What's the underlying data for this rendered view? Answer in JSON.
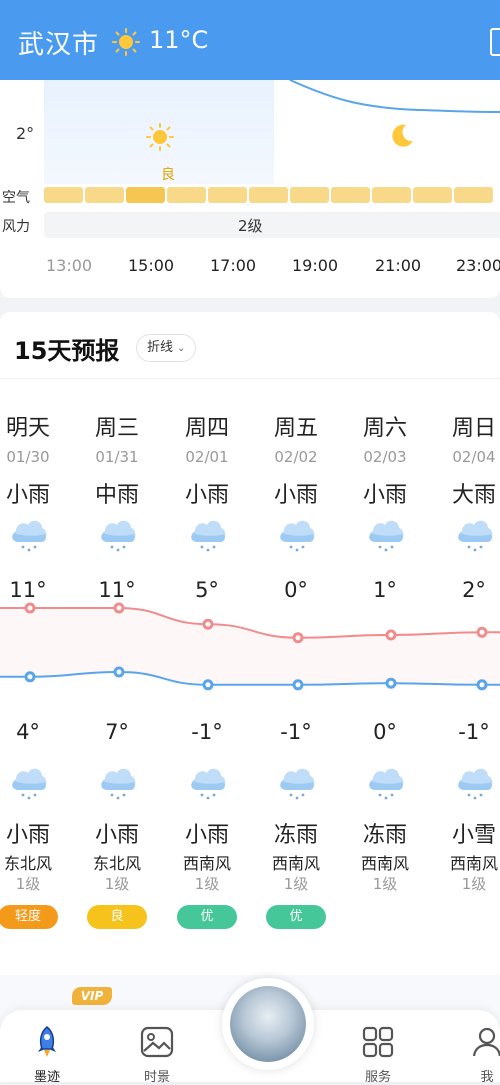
{
  "header": {
    "city": "武汉市",
    "temperature": "11°C",
    "weather_icon": "sun-icon"
  },
  "hourly": {
    "temp_axis_label": "2°",
    "aqi_label": "良",
    "air_row_label": "空气",
    "wind_row_label": "风力",
    "wind_value": "2级",
    "hours": [
      "13:00",
      "15:00",
      "17:00",
      "19:00",
      "21:00",
      "23:00"
    ]
  },
  "forecast": {
    "title": "15天预报",
    "mode_label": "折线",
    "days": [
      {
        "day": "明天",
        "date": "01/30",
        "day_weather": "小雨",
        "high": "11°",
        "low": "4°",
        "night_weather": "小雨",
        "wind_dir": "东北风",
        "wind_level": "1级",
        "aqi": "轻度",
        "aqi_color": "#f39a1a"
      },
      {
        "day": "周三",
        "date": "01/31",
        "day_weather": "中雨",
        "high": "11°",
        "low": "7°",
        "night_weather": "小雨",
        "wind_dir": "东北风",
        "wind_level": "1级",
        "aqi": "良",
        "aqi_color": "#f6c21c"
      },
      {
        "day": "周四",
        "date": "02/01",
        "day_weather": "小雨",
        "high": "5°",
        "low": "-1°",
        "night_weather": "小雨",
        "wind_dir": "西南风",
        "wind_level": "1级",
        "aqi": "优",
        "aqi_color": "#45c79a"
      },
      {
        "day": "周五",
        "date": "02/02",
        "day_weather": "小雨",
        "high": "0°",
        "low": "-1°",
        "night_weather": "冻雨",
        "wind_dir": "西南风",
        "wind_level": "1级",
        "aqi": "优",
        "aqi_color": "#45c79a"
      },
      {
        "day": "周六",
        "date": "02/03",
        "day_weather": "小雨",
        "high": "1°",
        "low": "0°",
        "night_weather": "冻雨",
        "wind_dir": "西南风",
        "wind_level": "1级",
        "aqi": "",
        "aqi_color": ""
      },
      {
        "day": "周日",
        "date": "02/04",
        "day_weather": "大雨",
        "high": "2°",
        "low": "-1°",
        "night_weather": "小雪",
        "wind_dir": "西南风",
        "wind_level": "1级",
        "aqi": "",
        "aqi_color": ""
      }
    ]
  },
  "chart_data": {
    "type": "line",
    "categories": [
      "01/30",
      "01/31",
      "02/01",
      "02/02",
      "02/03",
      "02/04"
    ],
    "series": [
      {
        "values": [
          11,
          11,
          5,
          0,
          1,
          2
        ],
        "color": "#f08c8c"
      },
      {
        "values": [
          4,
          7,
          -1,
          -1,
          0,
          -1
        ],
        "color": "#5aa5ea"
      }
    ]
  },
  "promo": {
    "vip_badge": "VIP"
  },
  "tabbar": {
    "tabs": [
      {
        "label": "墨迹",
        "icon": "rocket-icon"
      },
      {
        "label": "时景",
        "icon": "picture-icon"
      },
      {
        "label": "",
        "icon": "sky-photo"
      },
      {
        "label": "服务",
        "icon": "grid-icon"
      },
      {
        "label": "我",
        "icon": "user-icon"
      }
    ]
  }
}
